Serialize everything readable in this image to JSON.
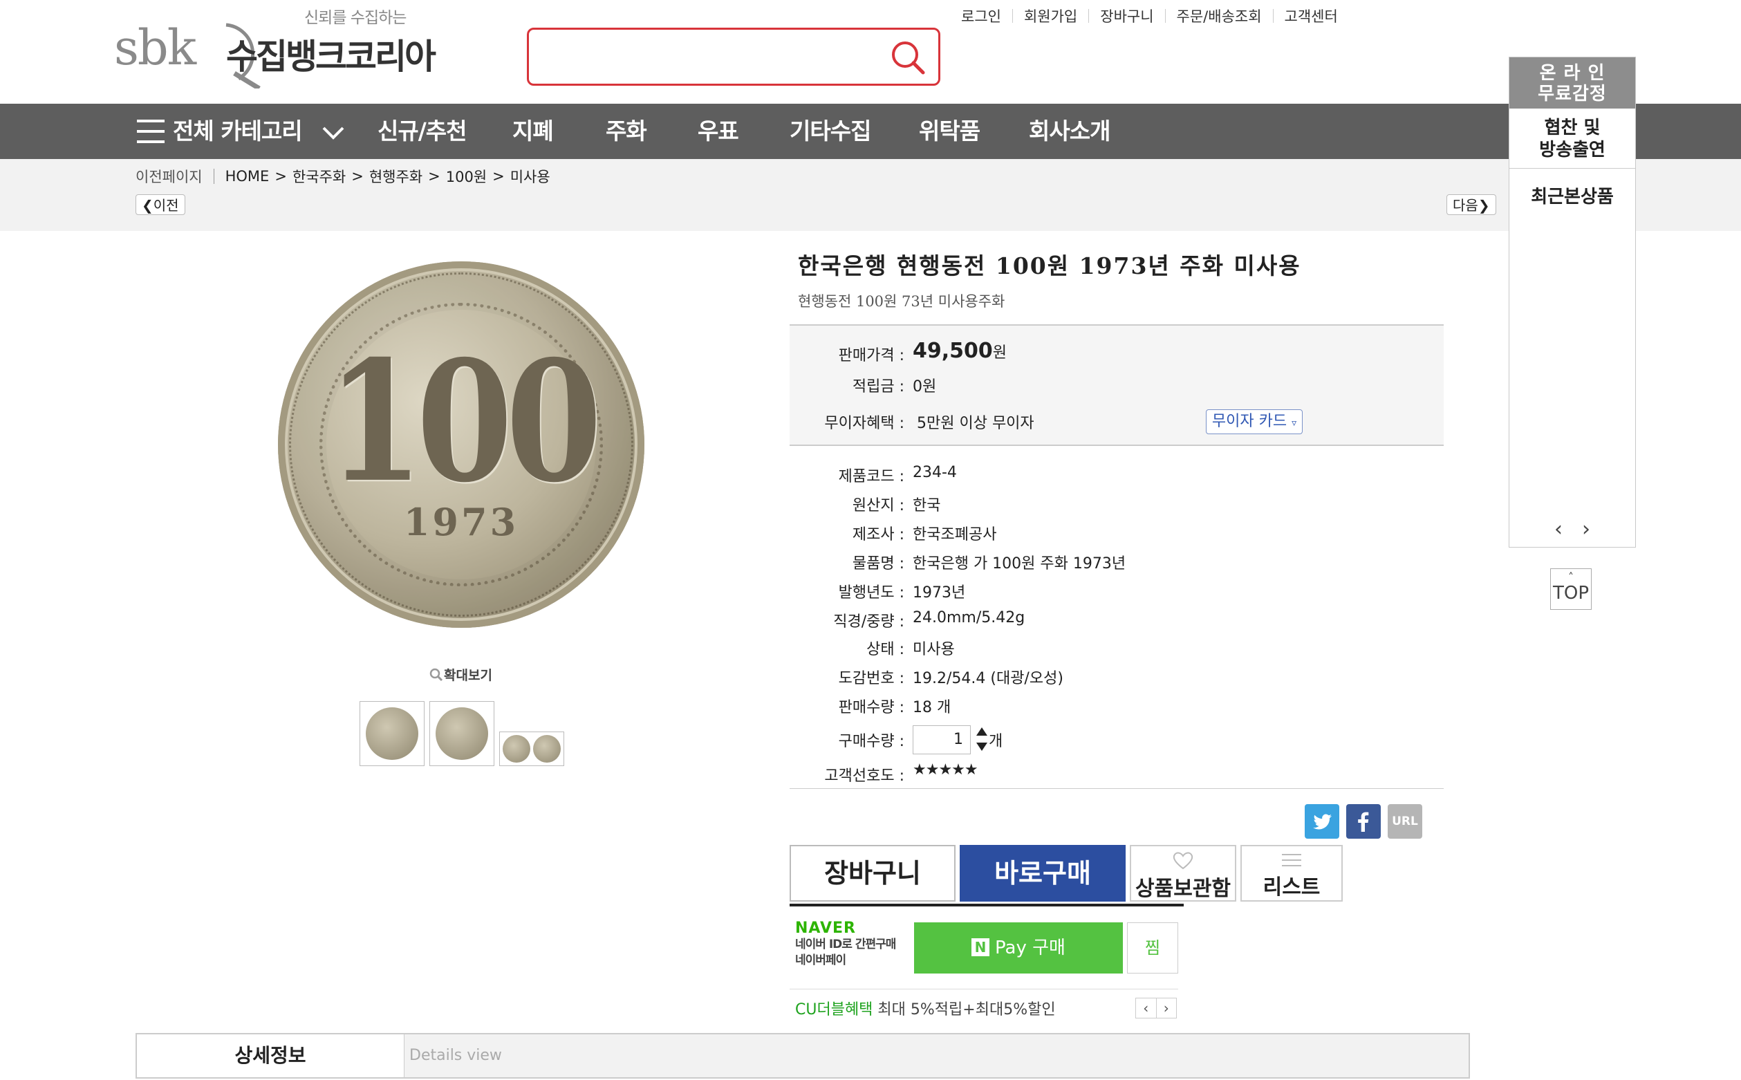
{
  "header": {
    "logo_tagline": "신뢰를 수집하는",
    "logo_mark": "sbk",
    "logo_name": "수집뱅크코리아",
    "top_links": [
      "로그인",
      "회원가입",
      "장바구니",
      "주문/배송조회",
      "고객센터"
    ]
  },
  "nav": {
    "all_categories": "전체 카테고리",
    "items": [
      "신규/추천",
      "지폐",
      "주화",
      "우표",
      "기타수집",
      "위탁품",
      "회사소개"
    ]
  },
  "breadcrumb": {
    "prev_page": "이전페이지",
    "path": [
      "HOME",
      "한국주화",
      "현행주화",
      "100원",
      "미사용"
    ],
    "prev_button": "이전",
    "next_button": "다음"
  },
  "right_rail": {
    "line1a": "온 라 인",
    "line1b": "무료감정",
    "line2a": "협찬 및",
    "line2b": "방송출연",
    "line3": "최근본상품",
    "top": "TOP"
  },
  "image": {
    "coin_value": "100",
    "coin_year": "1973",
    "zoom_label": "확대보기"
  },
  "product": {
    "title": "한국은행 현행동전 100원 1973년 주화 미사용",
    "subtitle": "현행동전 100원 73년 미사용주화",
    "price_label": "판매가격 :",
    "price_value": "49,500",
    "price_unit": "원",
    "points_label": "적립금 :",
    "points_value": "0원",
    "interest_label": "무이자혜택 :",
    "interest_value": "5만원 이상 무이자",
    "card_button": "무이자 카드",
    "specs": [
      {
        "label": "제품코드 :",
        "value": "234-4"
      },
      {
        "label": "원산지 :",
        "value": "한국"
      },
      {
        "label": "제조사 :",
        "value": "한국조폐공사"
      },
      {
        "label": "물품명 :",
        "value": "한국은행 가 100원 주화 1973년"
      },
      {
        "label": "발행년도 :",
        "value": "1973년"
      },
      {
        "label": "직경/중량 :",
        "value": "24.0mm/5.42g"
      },
      {
        "label": "상태 :",
        "value": "미사용"
      },
      {
        "label": "도감번호 :",
        "value": "19.2/54.4 (대광/오성)"
      },
      {
        "label": "판매수량 :",
        "value": "18 개"
      }
    ],
    "qty_label": "구매수량 :",
    "qty_value": "1",
    "qty_unit": "개",
    "pref_label": "고객선호도 :",
    "pref_value": "★★★★★"
  },
  "share": {
    "url": "URL"
  },
  "actions": {
    "cart": "장바구니",
    "buy": "바로구매",
    "wish": "상품보관함",
    "list": "리스트"
  },
  "naver": {
    "brand": "NAVER",
    "desc1": "네이버 ID로 간편구매",
    "desc2": "네이버페이",
    "pay_logo": "N",
    "pay_button": "Pay 구매",
    "zzim": "찜"
  },
  "cu": {
    "highlight": "CU더블혜택",
    "text": " 최대 5%적립+최대5%할인"
  },
  "tabs": {
    "detail": "상세정보",
    "detail_en": "Details view"
  },
  "colors": {
    "brand_red": "#d8343a",
    "nav_gray": "#5e5e5e",
    "buy_blue": "#2c4ea0",
    "naver_green": "#54c241"
  }
}
